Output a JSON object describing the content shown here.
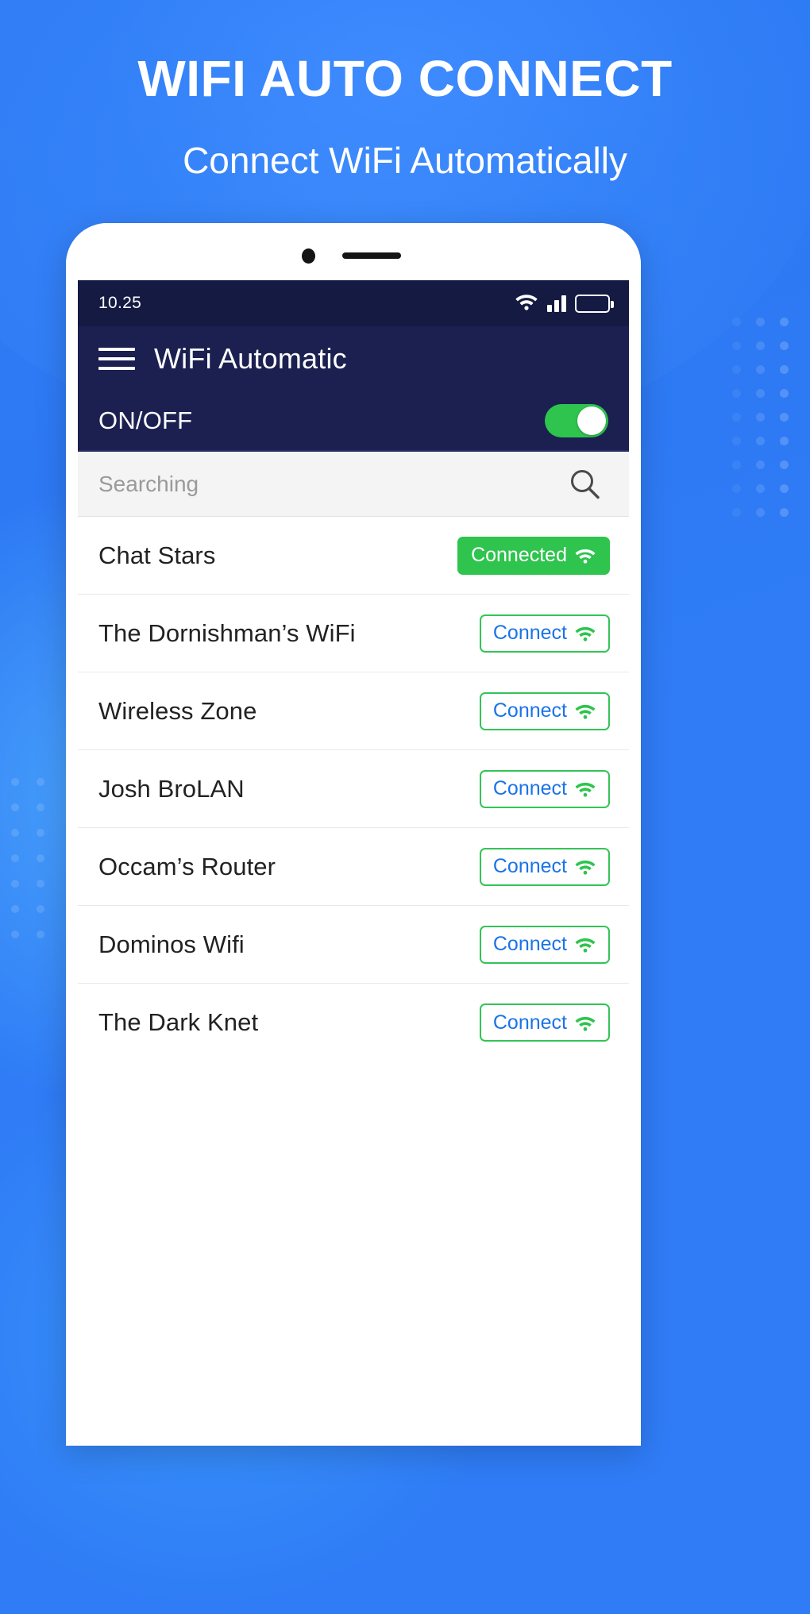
{
  "promo": {
    "title": "WIFI AUTO CONNECT",
    "subtitle": "Connect WiFi Automatically",
    "bg_color": "#2f7cf6",
    "accent_green": "#2ec44e",
    "accent_blue": "#1a73e8"
  },
  "phone": {
    "statusbar": {
      "time": "10.25",
      "icons": [
        "wifi-icon",
        "signal-icon",
        "battery-icon"
      ],
      "battery_level": 80,
      "bg_color": "#141a42"
    },
    "appbar": {
      "menu_icon": "hamburger-icon",
      "title": "WiFi Automatic",
      "bg_color": "#1b2050"
    },
    "onoff": {
      "label": "ON/OFF",
      "state": "on"
    },
    "search": {
      "placeholder": "Searching",
      "value": "",
      "icon": "search-icon"
    },
    "networks": [
      {
        "ssid": "Chat Stars",
        "action": "Connected",
        "state": "connected"
      },
      {
        "ssid": "The Dornishman’s WiFi",
        "action": "Connect",
        "state": "available"
      },
      {
        "ssid": "Wireless Zone",
        "action": "Connect",
        "state": "available"
      },
      {
        "ssid": "Josh BroLAN",
        "action": "Connect",
        "state": "available"
      },
      {
        "ssid": "Occam’s Router",
        "action": "Connect",
        "state": "available"
      },
      {
        "ssid": "Dominos Wifi",
        "action": "Connect",
        "state": "available"
      },
      {
        "ssid": "The Dark Knet",
        "action": "Connect",
        "state": "available"
      }
    ]
  }
}
